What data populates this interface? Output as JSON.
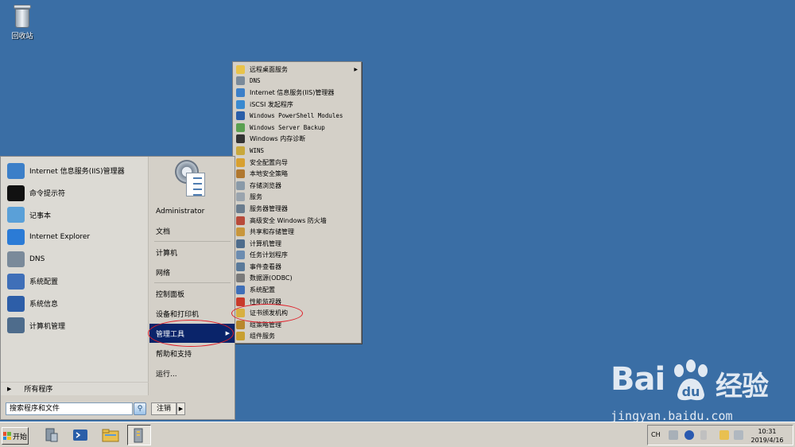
{
  "desktop": {
    "recycle_bin_label": "回收站"
  },
  "start_menu": {
    "pinned": [
      {
        "label": "Internet 信息服务(IIS)管理器",
        "icon": "iis-manager-icon",
        "color": "#3c7fc8"
      },
      {
        "label": "命令提示符",
        "icon": "command-prompt-icon",
        "color": "#111111"
      },
      {
        "label": "记事本",
        "icon": "notepad-icon",
        "color": "#5aa0d8"
      },
      {
        "label": "Internet Explorer",
        "icon": "internet-explorer-icon",
        "color": "#2b7bd6"
      },
      {
        "label": "DNS",
        "icon": "dns-icon",
        "color": "#7a8a9a"
      },
      {
        "label": "系统配置",
        "icon": "system-config-icon",
        "color": "#3f6fb8"
      },
      {
        "label": "系统信息",
        "icon": "system-info-icon",
        "color": "#2d5ea8"
      },
      {
        "label": "计算机管理",
        "icon": "computer-management-icon",
        "color": "#4e6c8c"
      }
    ],
    "all_programs": "所有程序",
    "search_placeholder": "搜索程序和文件",
    "logoff": "注销",
    "right": [
      {
        "label": "Administrator"
      },
      {
        "label": "文档"
      },
      {
        "label": "计算机"
      },
      {
        "label": "网络"
      },
      {
        "label": "控制面板"
      },
      {
        "label": "设备和打印机"
      },
      {
        "label": "管理工具"
      },
      {
        "label": "帮助和支持"
      },
      {
        "label": "运行..."
      }
    ],
    "selected_item": "管理工具"
  },
  "submenu": {
    "items": [
      {
        "label": "远程桌面服务",
        "icon": "folder-icon",
        "color": "#e8c34a",
        "has_submenu": true
      },
      {
        "label": "DNS",
        "icon": "dns-icon",
        "color": "#7a8a9a"
      },
      {
        "label": "Internet 信息服务(IIS)管理器",
        "icon": "iis-manager-icon",
        "color": "#3c7fc8"
      },
      {
        "label": "iSCSI 发起程序",
        "icon": "iscsi-icon",
        "color": "#3a8ad0"
      },
      {
        "label": "Windows PowerShell Modules",
        "icon": "powershell-icon",
        "color": "#2a5ea8"
      },
      {
        "label": "Windows Server Backup",
        "icon": "backup-icon",
        "color": "#5aa050"
      },
      {
        "label": "Windows 内存诊断",
        "icon": "memory-diagnostic-icon",
        "color": "#333333"
      },
      {
        "label": "WINS",
        "icon": "wins-icon",
        "color": "#c8a83c"
      },
      {
        "label": "安全配置向导",
        "icon": "security-wizard-icon",
        "color": "#d8a030"
      },
      {
        "label": "本地安全策略",
        "icon": "local-security-policy-icon",
        "color": "#b07830"
      },
      {
        "label": "存储浏览器",
        "icon": "storage-explorer-icon",
        "color": "#8a9aa8"
      },
      {
        "label": "服务",
        "icon": "services-icon",
        "color": "#9aa4ae"
      },
      {
        "label": "服务器管理器",
        "icon": "server-manager-icon",
        "color": "#6a7c8e"
      },
      {
        "label": "高级安全 Windows 防火墙",
        "icon": "firewall-icon",
        "color": "#b84a3a"
      },
      {
        "label": "共享和存储管理",
        "icon": "share-storage-icon",
        "color": "#c8963c"
      },
      {
        "label": "计算机管理",
        "icon": "computer-management-icon",
        "color": "#4e6c8c"
      },
      {
        "label": "任务计划程序",
        "icon": "task-scheduler-icon",
        "color": "#6c8cb0"
      },
      {
        "label": "事件查看器",
        "icon": "event-viewer-icon",
        "color": "#5a7a9a"
      },
      {
        "label": "数据源(ODBC)",
        "icon": "odbc-icon",
        "color": "#7a7a7a"
      },
      {
        "label": "系统配置",
        "icon": "system-config-icon",
        "color": "#3f6fb8"
      },
      {
        "label": "性能监视器",
        "icon": "performance-monitor-icon",
        "color": "#c83a2a"
      },
      {
        "label": "证书颁发机构",
        "icon": "certificate-authority-icon",
        "color": "#d8b040"
      },
      {
        "label": "组策略管理",
        "icon": "group-policy-icon",
        "color": "#b8882c"
      },
      {
        "label": "组件服务",
        "icon": "component-services-icon",
        "color": "#c8a030"
      }
    ]
  },
  "taskbar": {
    "start_label": "开始",
    "quick_launch": [
      {
        "icon": "server-manager-icon"
      },
      {
        "icon": "powershell-icon"
      },
      {
        "icon": "explorer-icon"
      },
      {
        "icon": "admin-tools-icon"
      }
    ],
    "tray": {
      "lang": "CH",
      "time": "10:31",
      "date": "2019/4/16"
    }
  },
  "watermark": {
    "logo_text": "Bai",
    "logo_text2": "经验",
    "url": "jingyan.baidu.com"
  },
  "annotation_color": "#e0202a"
}
